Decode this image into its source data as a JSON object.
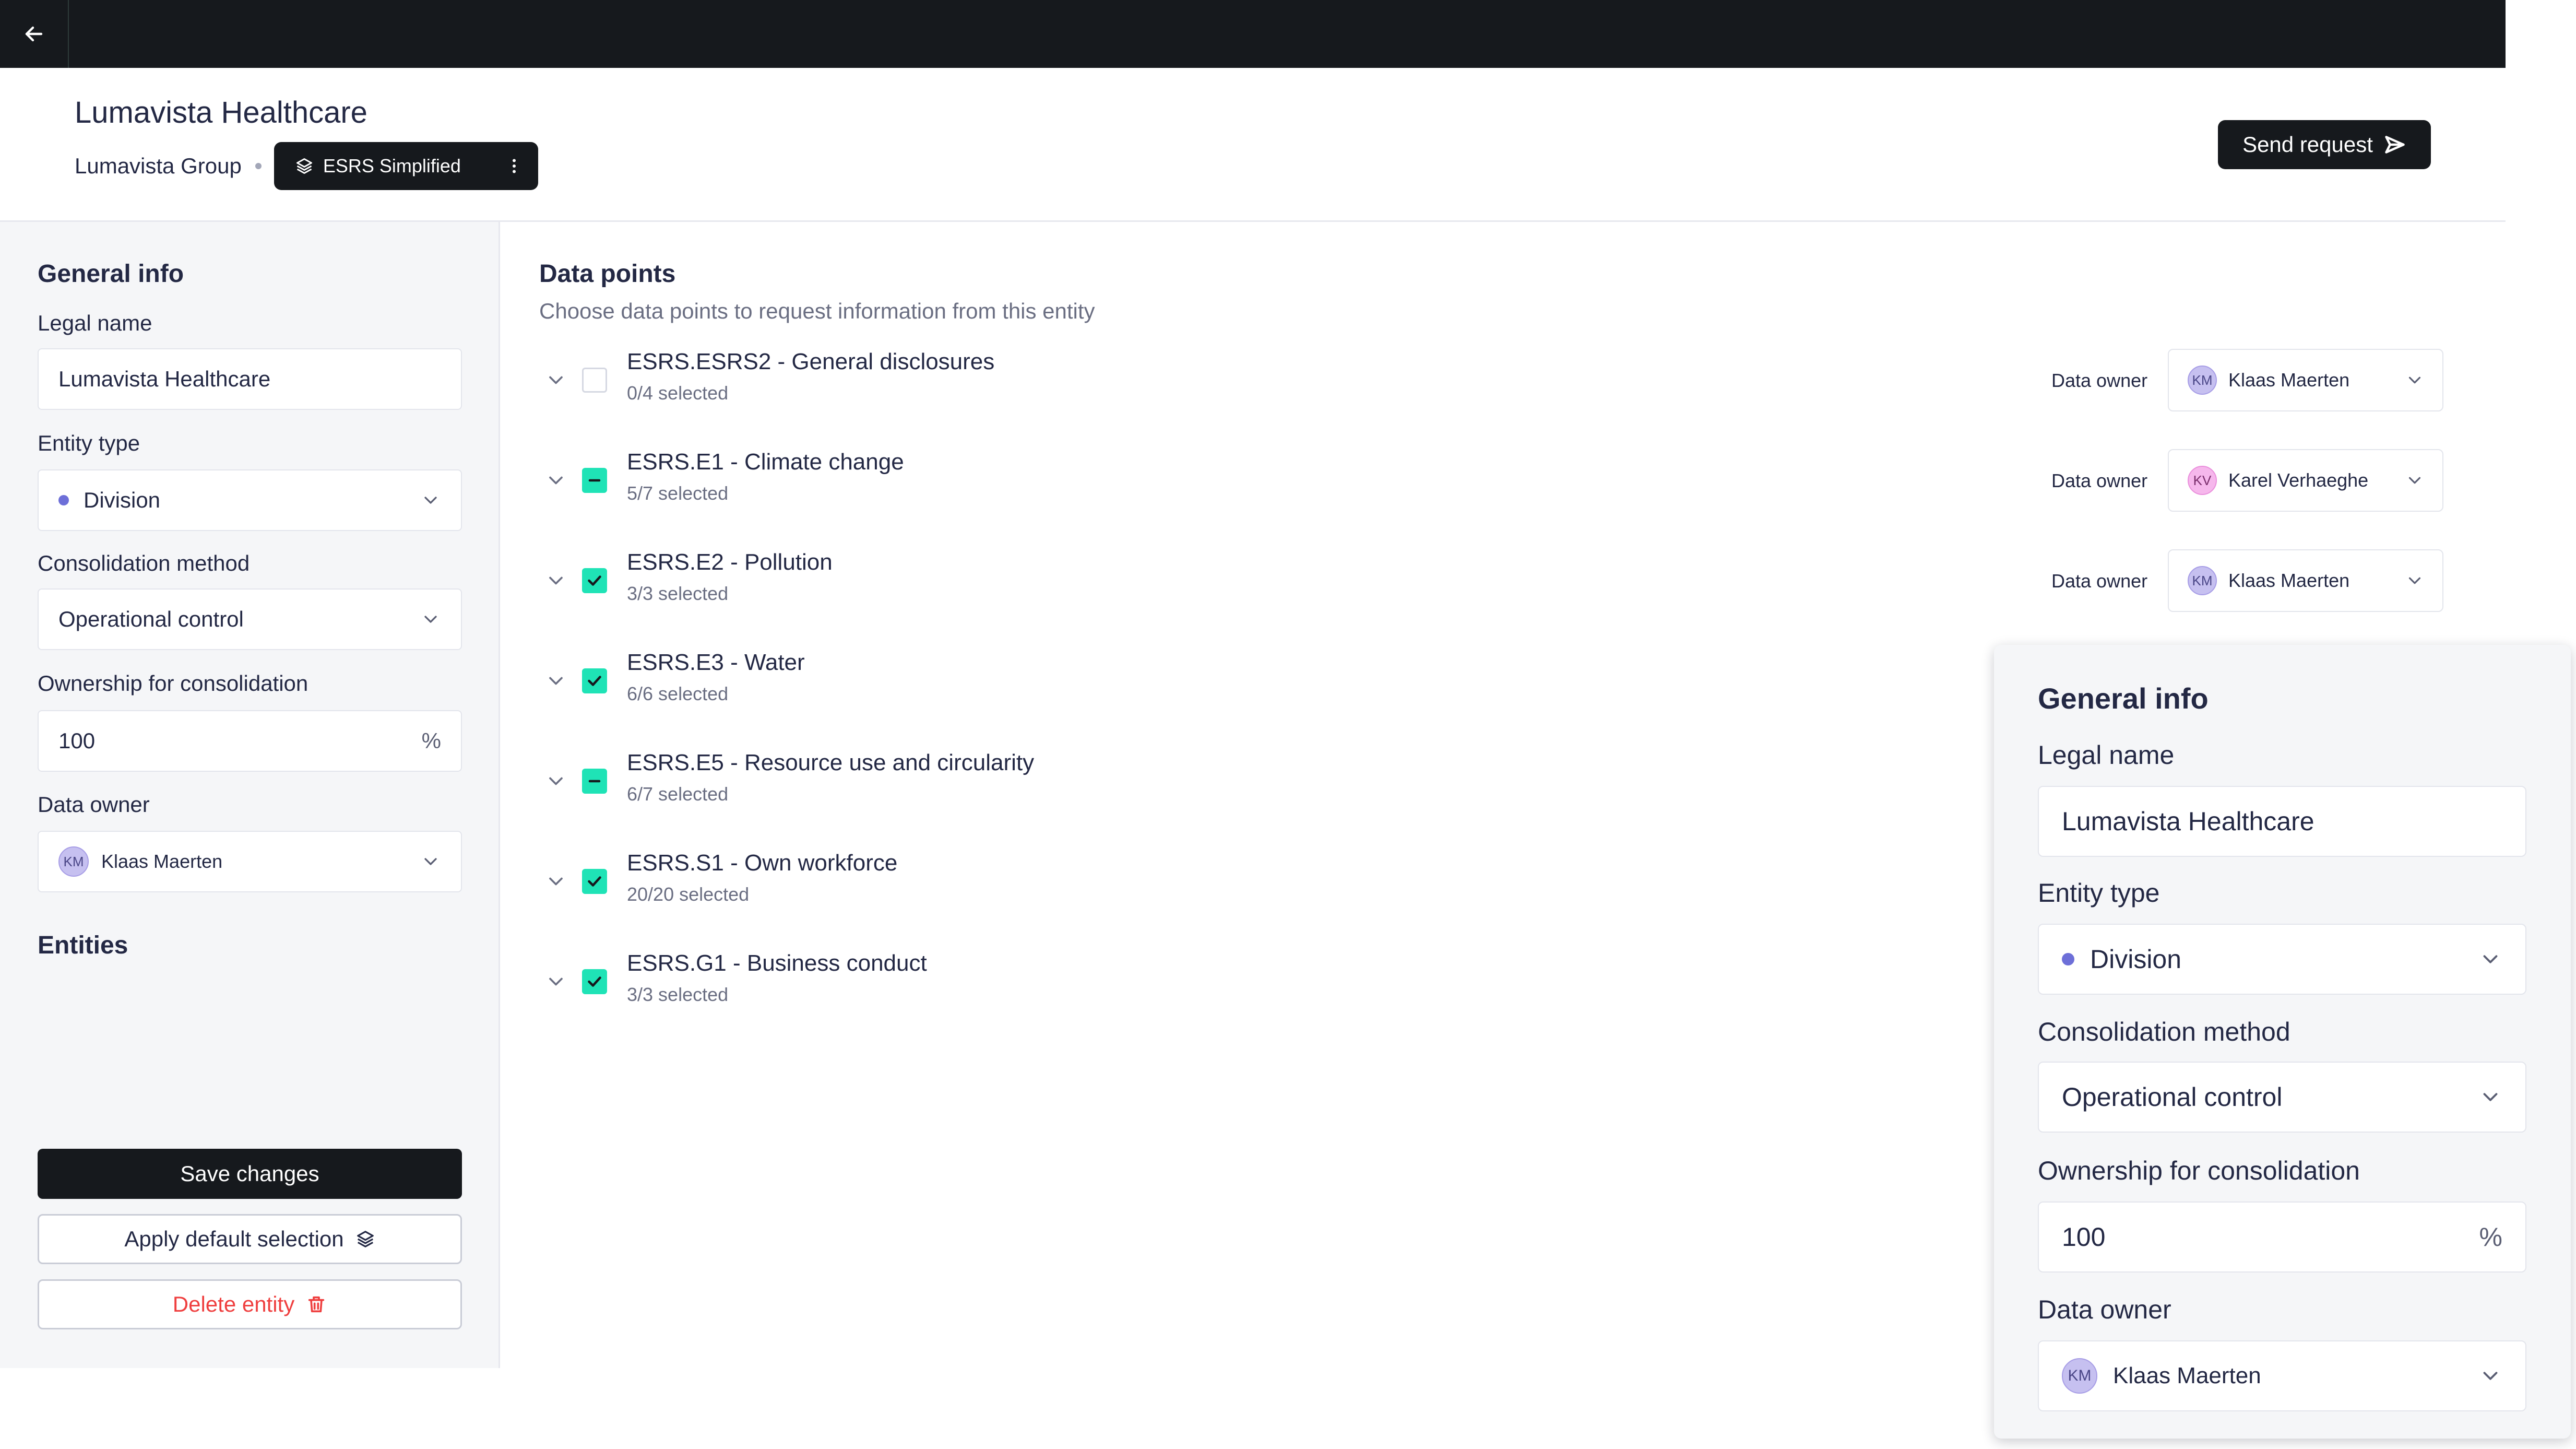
{
  "header": {
    "entity_title": "Lumavista Healthcare",
    "group_name": "Lumavista Group",
    "framework_label": "ESRS Simplified",
    "send_request_label": "Send request"
  },
  "left_panel": {
    "general_info_title": "General info",
    "legal_name_label": "Legal name",
    "legal_name_value": "Lumavista Healthcare",
    "entity_type_label": "Entity type",
    "entity_type_value": "Division",
    "consolidation_label": "Consolidation method",
    "consolidation_value": "Operational control",
    "ownership_label": "Ownership for consolidation",
    "ownership_value": "100",
    "ownership_unit": "%",
    "data_owner_label": "Data owner",
    "data_owner_initials": "KM",
    "data_owner_name": "Klaas Maerten",
    "entities_title": "Entities",
    "save_label": "Save changes",
    "apply_default_label": "Apply default selection",
    "delete_label": "Delete entity"
  },
  "data_points": {
    "title": "Data points",
    "subtitle": "Choose data points to request information from this entity",
    "owner_label": "Data owner",
    "items": [
      {
        "name": "ESRS.ESRS2 - General disclosures",
        "count": "0/4 selected",
        "state": "none",
        "owner_initials": "KM",
        "owner_name": "Klaas Maerten"
      },
      {
        "name": "ESRS.E1 - Climate change",
        "count": "5/7 selected",
        "state": "partial",
        "owner_initials": "KV",
        "owner_name": "Karel Verhaeghe"
      },
      {
        "name": "ESRS.E2 - Pollution",
        "count": "3/3 selected",
        "state": "all",
        "owner_initials": "KM",
        "owner_name": "Klaas Maerten"
      },
      {
        "name": "ESRS.E3 - Water",
        "count": "6/6 selected",
        "state": "all"
      },
      {
        "name": "ESRS.E5 - Resource use and circularity",
        "count": "6/7 selected",
        "state": "partial"
      },
      {
        "name": "ESRS.S1 - Own workforce",
        "count": "20/20 selected",
        "state": "all"
      },
      {
        "name": "ESRS.G1 - Business conduct",
        "count": "3/3 selected",
        "state": "all"
      }
    ]
  },
  "float_panel": {
    "title": "General info",
    "legal_name_label": "Legal name",
    "legal_name_value": "Lumavista Healthcare",
    "entity_type_label": "Entity type",
    "entity_type_value": "Division",
    "consolidation_label": "Consolidation method",
    "consolidation_value": "Operational control",
    "ownership_label": "Ownership for consolidation",
    "ownership_value": "100",
    "ownership_unit": "%",
    "data_owner_label": "Data owner",
    "data_owner_initials": "KM",
    "data_owner_name": "Klaas Maerten"
  },
  "colors": {
    "dark": "#16191d",
    "accent_check": "#1fe3b6",
    "danger": "#ef3f3f",
    "bullet": "#6d6fd8",
    "avatar_km": "#c6c0f0",
    "avatar_kv": "#f6b7ec"
  }
}
